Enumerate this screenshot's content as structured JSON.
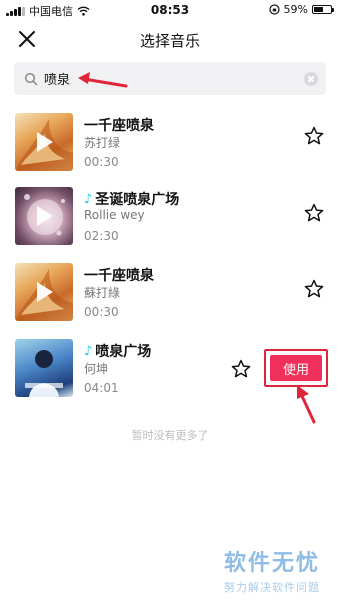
{
  "status_bar": {
    "carrier": "中国电信",
    "time": "08:53",
    "battery": "59%",
    "battery_level": 0.59
  },
  "nav": {
    "title": "选择音乐"
  },
  "search": {
    "value": "喷泉",
    "placeholder": ""
  },
  "songs": [
    {
      "title": "一千座喷泉",
      "artist": "苏打绿",
      "duration": "00:30",
      "has_music_note": false
    },
    {
      "title": "圣诞喷泉广场",
      "artist": "Rollie wey",
      "duration": "02:30",
      "has_music_note": true
    },
    {
      "title": "一千座喷泉",
      "artist": "蘇打綠",
      "duration": "00:30",
      "has_music_note": false
    },
    {
      "title": "喷泉广场",
      "artist": "何坤",
      "duration": "04:01",
      "has_music_note": true
    }
  ],
  "use_button": {
    "label": "使用"
  },
  "empty_text": "暂时没有更多了",
  "watermark": {
    "title": "软件无忧",
    "subtitle": "努力解决软件问题"
  },
  "colors": {
    "accent": "#f0305a",
    "annotation": "#e0243a",
    "music_note": "#20c8e0"
  }
}
